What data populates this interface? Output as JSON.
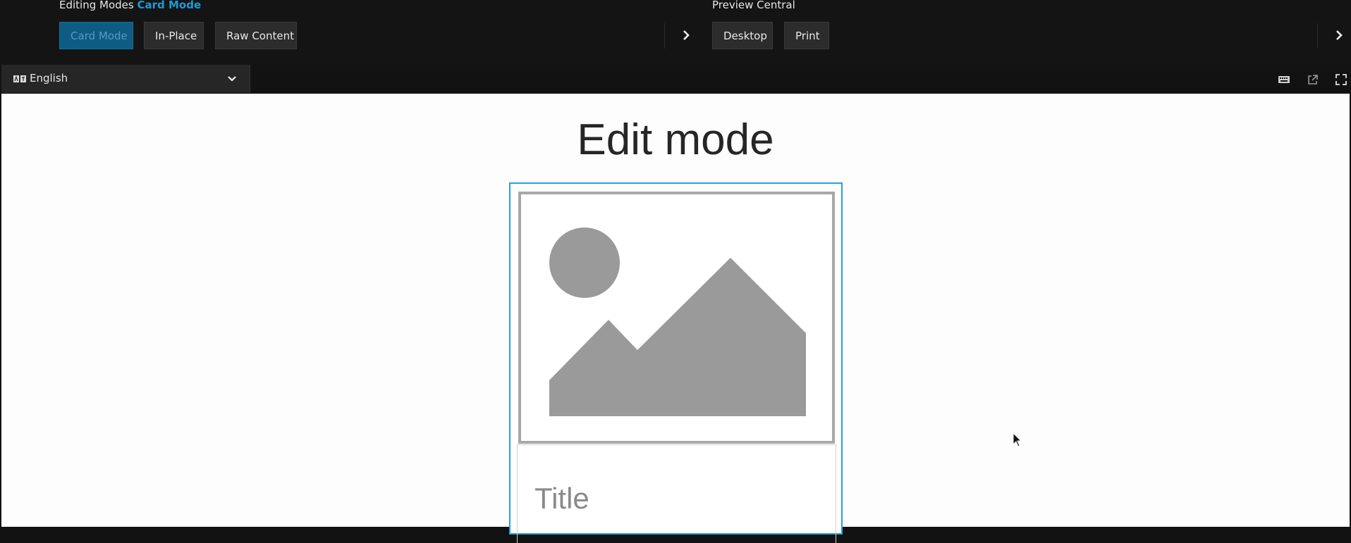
{
  "toolbar": {
    "editing_modes": {
      "label": "Editing Modes",
      "current_mode": "Card Mode",
      "buttons": [
        {
          "label": "Card Mode",
          "active": true
        },
        {
          "label": "In-Place",
          "active": false
        },
        {
          "label": "Raw Content",
          "active": false
        }
      ]
    },
    "preview": {
      "label": "Preview Central",
      "buttons": [
        {
          "label": "Desktop"
        },
        {
          "label": "Print"
        }
      ]
    }
  },
  "language": {
    "selected": "English"
  },
  "page": {
    "title": "Edit mode",
    "card": {
      "title": "Title"
    }
  },
  "colors": {
    "accent": "#1e9ad6",
    "active_button_bg": "#0e5c84",
    "toolbar_bg": "#141414",
    "card_border": "#2aa1da",
    "placeholder_gray": "#9a9a9a"
  },
  "icons": [
    "chevron-right-icon",
    "translate-icon",
    "chevron-down-icon",
    "keyboard-icon",
    "external-link-icon",
    "fullscreen-icon",
    "mouse-cursor-icon",
    "image-placeholder-icon"
  ]
}
